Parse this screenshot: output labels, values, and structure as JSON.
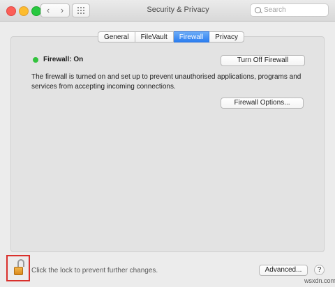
{
  "titlebar": {
    "title": "Security & Privacy",
    "back_icon": "‹",
    "forward_icon": "›",
    "search_placeholder": "Search"
  },
  "tabs": [
    {
      "label": "General",
      "active": false
    },
    {
      "label": "FileVault",
      "active": false
    },
    {
      "label": "Firewall",
      "active": true
    },
    {
      "label": "Privacy",
      "active": false
    }
  ],
  "firewall": {
    "status_label": "Firewall: On",
    "status_color": "#33c33e",
    "turn_off_label": "Turn Off Firewall",
    "description": "The firewall is turned on and set up to prevent unauthorised applications, programs and services from accepting incoming connections.",
    "options_label": "Firewall Options..."
  },
  "footer": {
    "lock_text": "Click the lock to prevent further changes.",
    "advanced_label": "Advanced...",
    "help_label": "?"
  },
  "watermark": "wsxdn.com"
}
